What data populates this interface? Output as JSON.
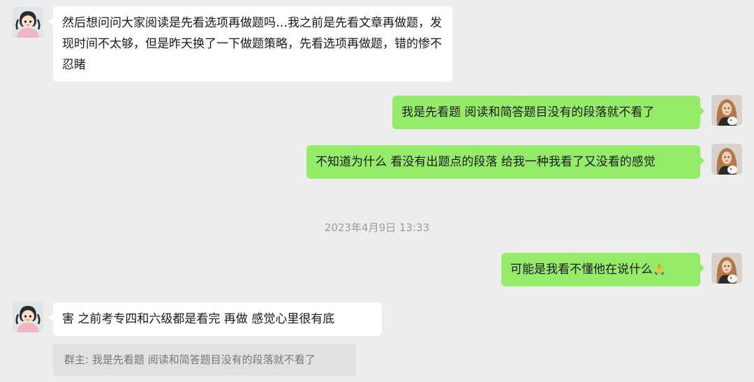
{
  "messages": [
    {
      "side": "left",
      "text": "然后想问问大家阅读是先看选项再做题吗…我之前是先看文章再做题，发现时间不太够，但是昨天换了一下做题策略，先看选项再做题，错的惨不忍睹"
    },
    {
      "side": "right",
      "text": "我是先看题 阅读和简答题目没有的段落就不看了"
    },
    {
      "side": "right",
      "text": "不知道为什么 看没有出题点的段落 给我一种我看了又没看的感觉"
    },
    {
      "side": "right",
      "text": "可能是我看不懂他在说什么"
    },
    {
      "side": "left",
      "text": "害 之前考专四和六级都是看完 再做 感觉心里很有底"
    }
  ],
  "timestamp": "2023年4月9日 13:33",
  "quote": {
    "text": "群主: 我是先看题 阅读和简答题目没有的段落就不看了"
  },
  "icons": {
    "reaction": "folded-hands-emoji"
  },
  "colors": {
    "background": "#ededed",
    "self_bubble": "#95ec69",
    "other_bubble": "#ffffff",
    "quote_bg": "#e1e1e1"
  }
}
